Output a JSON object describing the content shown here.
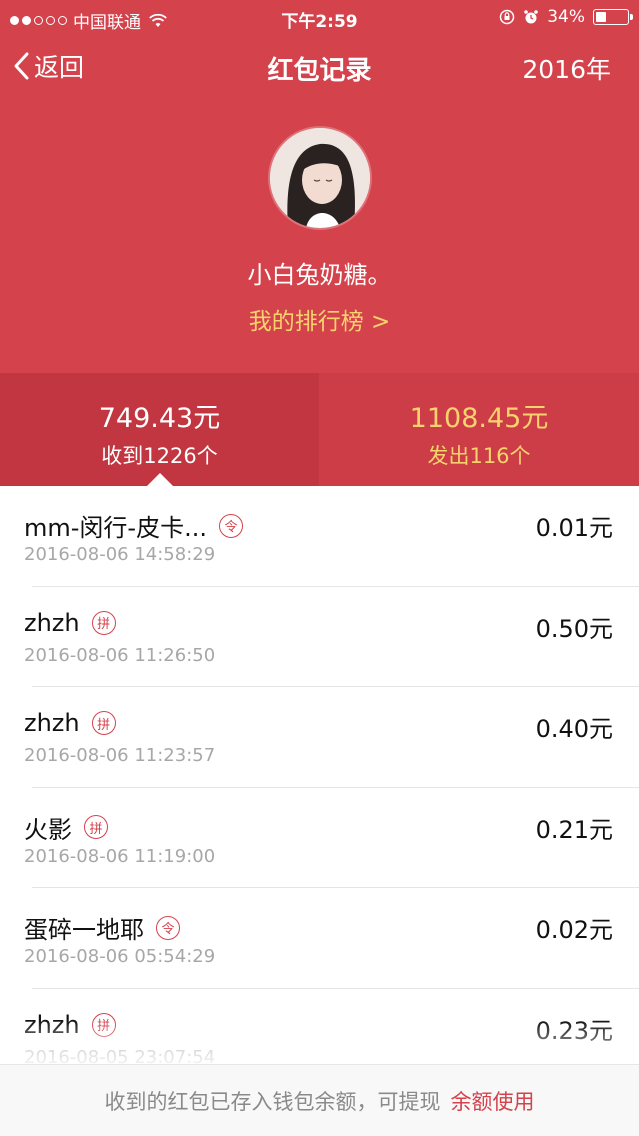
{
  "status_bar": {
    "carrier": "中国联通",
    "time": "下午2:59",
    "battery": "34%",
    "battery_level": 0.34,
    "signal_bars_filled": 2,
    "signal_bars_total": 5
  },
  "nav": {
    "back_label": "返回",
    "title": "红包记录",
    "year": "2016年"
  },
  "profile": {
    "username": "小白兔奶糖。",
    "ranking_link": "我的排行榜 >"
  },
  "stats": {
    "received_amount": "749.43元",
    "received_count": "收到1226个",
    "sent_amount": "1108.45元",
    "sent_count": "发出116个"
  },
  "records": [
    {
      "name": "mm-闵行-皮卡...",
      "tag": "令",
      "time": "2016-08-06 14:58:29",
      "amount": "0.01元"
    },
    {
      "name": "zhzh",
      "tag": "拼",
      "time": "2016-08-06 11:26:50",
      "amount": "0.50元"
    },
    {
      "name": "zhzh",
      "tag": "拼",
      "time": "2016-08-06 11:23:57",
      "amount": "0.40元"
    },
    {
      "name": "火影",
      "tag": "拼",
      "time": "2016-08-06 11:19:00",
      "amount": "0.21元"
    },
    {
      "name": "蛋碎一地耶",
      "tag": "令",
      "time": "2016-08-06 05:54:29",
      "amount": "0.02元"
    },
    {
      "name": "zhzh",
      "tag": "拼",
      "time": "2016-08-05 23:07:54",
      "amount": "0.23元"
    }
  ],
  "footer": {
    "text": "收到的红包已存入钱包余额，可提现",
    "link": "余额使用"
  },
  "colors": {
    "header_red": "#d4424c",
    "stat_active": "#c13641",
    "gold": "#f7d36d",
    "tag_red": "#d4424c"
  },
  "icons": [
    "signal-dots-icon",
    "wifi-icon",
    "orientation-lock-icon",
    "alarm-icon",
    "battery-icon",
    "back-chevron-icon",
    "avatar"
  ]
}
